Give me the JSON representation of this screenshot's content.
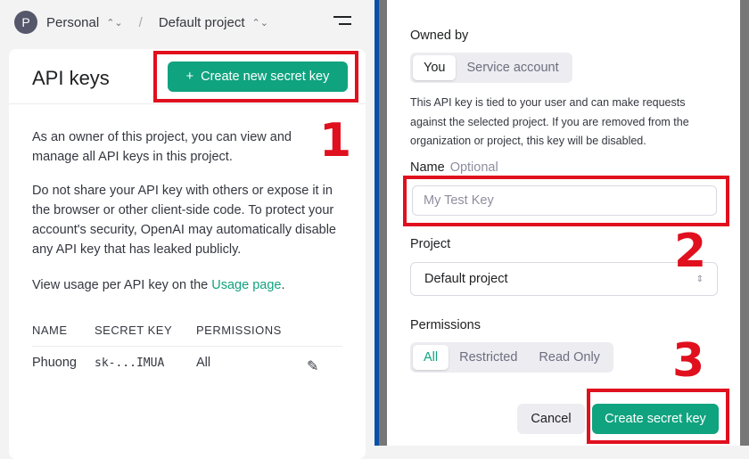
{
  "header": {
    "avatar": "P",
    "org": "Personal",
    "project": "Default project"
  },
  "card": {
    "title": "API keys",
    "create_button": "Create new secret key",
    "para1": "As an owner of this project, you can view and manage all API keys in this project.",
    "para2": "Do not share your API key with others or expose it in the browser or other client-side code. To protect your account's security, OpenAI may automatically disable any API key that has leaked publicly.",
    "para3_prefix": "View usage per API key on the ",
    "para3_link": "Usage page",
    "para3_suffix": ".",
    "columns": [
      "NAME",
      "SECRET KEY",
      "PERMISSIONS"
    ],
    "rows": [
      {
        "name": "Phuong",
        "key": "sk-...IMUA",
        "permissions": "All"
      }
    ]
  },
  "modal": {
    "owned_by_label": "Owned by",
    "owned_options": [
      "You",
      "Service account"
    ],
    "owned_selected": "You",
    "description": "This API key is tied to your user and can make requests against the selected project. If you are removed from the organization or project, this key will be disabled.",
    "name_label": "Name",
    "name_optional": "Optional",
    "name_placeholder": "My Test Key",
    "project_label": "Project",
    "project_value": "Default project",
    "permissions_label": "Permissions",
    "permission_options": [
      "All",
      "Restricted",
      "Read Only"
    ],
    "permission_selected": "All",
    "cancel": "Cancel",
    "create": "Create secret key"
  },
  "annotations": [
    "1",
    "2",
    "3"
  ],
  "colors": {
    "accent": "#10a37f",
    "annotation": "#e0101e"
  }
}
